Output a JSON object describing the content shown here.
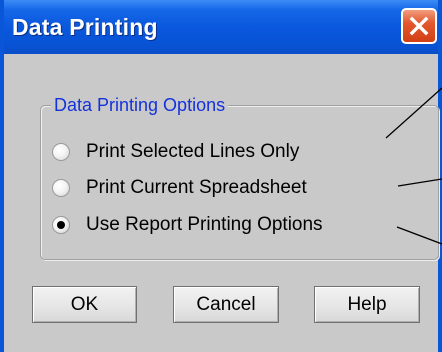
{
  "window": {
    "title": "Data Printing"
  },
  "title_bar": {
    "close_icon": "close-icon",
    "close_button_color": "#d94a1e"
  },
  "group": {
    "legend": "Data Printing Options",
    "legend_color": "#1432dc",
    "options": [
      {
        "label": "Print Selected Lines Only",
        "selected": false
      },
      {
        "label": "Print Current Spreadsheet",
        "selected": false
      },
      {
        "label": "Use Report Printing Options",
        "selected": true
      }
    ]
  },
  "buttons": {
    "ok": "OK",
    "cancel": "Cancel",
    "help": "Help"
  },
  "colors": {
    "title_bar": "#0a58dd",
    "dialog_background": "#c9c9c9"
  }
}
